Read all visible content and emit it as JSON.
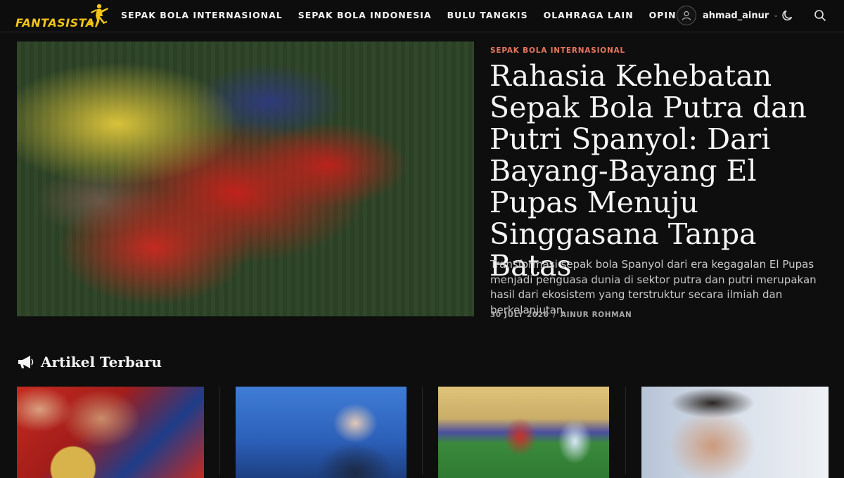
{
  "header": {
    "logo_text": "FANTASISTA",
    "nav": [
      {
        "label": "SEPAK BOLA INTERNASIONAL"
      },
      {
        "label": "SEPAK BOLA INDONESIA"
      },
      {
        "label": "BULU TANGKIS"
      },
      {
        "label": "OLAHRAGA LAIN"
      },
      {
        "label": "OPINI"
      }
    ],
    "username": "ahmad_ainur",
    "icons": [
      "user-icon",
      "chevron-down-icon",
      "moon-icon",
      "search-icon"
    ]
  },
  "hero": {
    "category": "SEPAK BOLA INTERNASIONAL",
    "title": "Rahasia Kehebatan Sepak Bola Putra dan Putri Spanyol: Dari Bayang-Bayang El Pupas Menuju Singgasana Tanpa Batas",
    "excerpt": "Transformasi sepak bola Spanyol dari era kegagalan El Pupas menjadi penguasa dunia di sektor putra dan putri merupakan hasil dari ekosistem yang terstruktur secara ilmiah dan berkelanjutan.",
    "date": "30 JULY 2026",
    "separator": "/",
    "author": "AINUR ROHMAN"
  },
  "latest": {
    "title": "Artikel Terbaru",
    "icon": "megaphone-icon"
  },
  "colors": {
    "background": "#0e0e0e",
    "accent": "#e8755f",
    "logo": "#f2c417"
  }
}
